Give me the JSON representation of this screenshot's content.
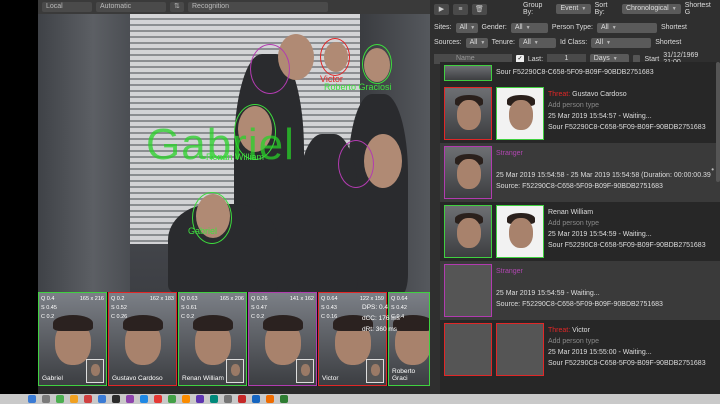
{
  "topbar": {
    "source": "Local",
    "mode": "Automatic",
    "recognition": "Recognition"
  },
  "video": {
    "big_overlay_name": "Gabriel",
    "labels": [
      {
        "text": "Victor",
        "color": "red"
      },
      {
        "text": "Roberto Graciosi",
        "color": "green"
      },
      {
        "text": "Renan William",
        "color": "green"
      },
      {
        "text": "Gabriel",
        "color": "green"
      }
    ]
  },
  "thumbnails": [
    {
      "name": "Gabriel",
      "q": "Q 0.4",
      "size": "165 x 216",
      "s": "S 0.45",
      "c": "C 0.2",
      "color": "green"
    },
    {
      "name": "Gustavo Cardoso",
      "q": "Q 0.2",
      "size": "162 x 183",
      "s": "S 0.52",
      "c": "C 0.26",
      "color": "red"
    },
    {
      "name": "Renan William",
      "q": "Q 0.63",
      "size": "165 x 206",
      "s": "S 0.61",
      "c": "C 0.2",
      "color": "green2"
    },
    {
      "name": "",
      "q": "Q 0.26",
      "size": "141 x 162",
      "s": "S 0.47",
      "c": "C 0.2",
      "color": "purple"
    },
    {
      "name": "Victor",
      "q": "Q 0.64",
      "size": "122 x 159",
      "s": "S 0.43",
      "c": "C 0.16",
      "color": "red"
    },
    {
      "name": "Roberto Graci",
      "q": "Q 0.64",
      "size": "",
      "s": "S 0.42",
      "c": "C 0.4",
      "color": "green"
    }
  ],
  "overlay_stats": {
    "dps": "DPS: 0.4",
    "dcc": "dCC: 176 ms",
    "drt": "dRt: 360 ms"
  },
  "panel": {
    "group_by_label": "Group By:",
    "group_by_value": "Event",
    "sort_by_label": "Sort By:",
    "sort_by_value": "Chronological",
    "shortest_label": "Shortest G",
    "shortest_label2": "Shortest",
    "sites_label": "Sites:",
    "sites_value": "All",
    "gender_label": "Gender:",
    "gender_value": "All",
    "person_type_label": "Person Type:",
    "person_type_value": "All",
    "sources_label": "Sources:",
    "sources_value": "All",
    "tenure_label": "Tenure:",
    "tenure_value": "All",
    "id_class_label": "Id Class:",
    "id_class_value": "All",
    "name_placeholder": "Name",
    "last_label": "Last:",
    "last_value": "1",
    "last_unit": "Days",
    "start_label": "Start",
    "start_value": "31/12/1969 21:00"
  },
  "events": [
    {
      "lines": [
        "Sour  F52290C8-C658-5F09-B09F-90BDB2751683"
      ],
      "kind": "partial"
    },
    {
      "threat": "Threat:",
      "name": "Gustavo Cardoso",
      "add": "Add person type",
      "time": "25 Mar 2019 15:54:57 - Waiting...",
      "source": "Sour  F52290C8-C658-5F09-B09F-90BDB2751683",
      "kind": "threat"
    },
    {
      "tag": "Stranger",
      "time": "25 Mar 2019 15:54:58 - 25 Mar 2019 15:54:58 (Duration: 00:00:00.39",
      "source": "Source:  F52290C8-C658-5F09-B09F-90BDB2751683",
      "kind": "stranger"
    },
    {
      "name": "Renan William",
      "add": "Add person type",
      "time": "25 Mar 2019 15:54:59 - Waiting...",
      "source": "Sour  F52290C8-C658-5F09-B09F-90BDB2751683",
      "kind": "known"
    },
    {
      "tag": "Stranger",
      "time": "25 Mar 2019 15:54:59 - Waiting...",
      "source": "Source:  F52290C8-C658-5F09-B09F-90BDB2751683",
      "kind": "stranger2"
    },
    {
      "threat": "Threat:",
      "name": "Victor",
      "add": "Add person type",
      "time": "25 Mar 2019 15:55:00 - Waiting...",
      "source": "Sour  F52290C8-C658-5F09-B09F-90BDB2751683",
      "kind": "threat2"
    }
  ],
  "colors": {
    "green": "#40d040",
    "red": "#e02727",
    "purple": "#b23bb0",
    "panel_bg": "#2f2f2f"
  }
}
